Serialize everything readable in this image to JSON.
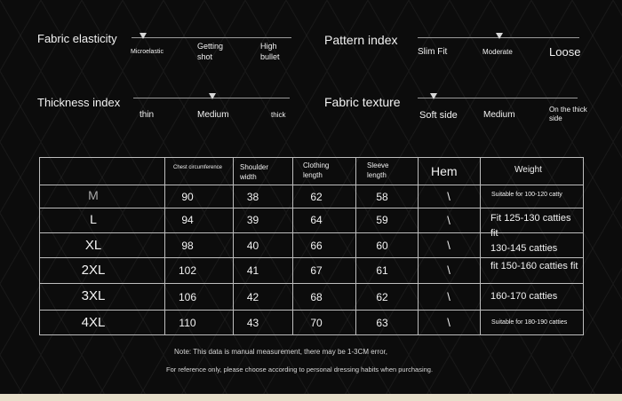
{
  "fabric_elasticity": {
    "title": "Fabric elasticity",
    "options": [
      "Microelastic",
      "Getting shot",
      "High bullet"
    ]
  },
  "pattern_index": {
    "title": "Pattern index",
    "options": [
      "Slim Fit",
      "Moderate",
      "Loose"
    ]
  },
  "thickness_index": {
    "title": "Thickness index",
    "options": [
      "thin",
      "Medium",
      "thick"
    ]
  },
  "fabric_texture": {
    "title": "Fabric texture",
    "options": [
      "Soft side",
      "Medium",
      "On the thick side"
    ]
  },
  "table": {
    "headers": [
      "Chest circumference",
      "Shoulder width",
      "Clothing length",
      "Sleeve length",
      "Hem",
      "Weight"
    ],
    "rows": [
      {
        "size": "M",
        "chest": "90",
        "shoulder": "38",
        "length": "62",
        "sleeve": "58",
        "hem": "\\",
        "weight": "Suitable for 100-120 catty"
      },
      {
        "size": "L",
        "chest": "94",
        "shoulder": "39",
        "length": "64",
        "sleeve": "59",
        "hem": "\\",
        "weight": "Fit 125-130 catties fit"
      },
      {
        "size": "XL",
        "chest": "98",
        "shoulder": "40",
        "length": "66",
        "sleeve": "60",
        "hem": "\\",
        "weight": "130-145 catties"
      },
      {
        "size": "2XL",
        "chest": "102",
        "shoulder": "41",
        "length": "67",
        "sleeve": "61",
        "hem": "\\",
        "weight": "fit 150-160 catties fit"
      },
      {
        "size": "3XL",
        "chest": "106",
        "shoulder": "42",
        "length": "68",
        "sleeve": "62",
        "hem": "\\",
        "weight": "160-170 catties"
      },
      {
        "size": "4XL",
        "chest": "110",
        "shoulder": "43",
        "length": "70",
        "sleeve": "63",
        "hem": "\\",
        "weight": "Suitable for 180-190 catties"
      }
    ]
  },
  "notes": {
    "line1": "Note: This data is manual measurement, there may be 1-3CM error,",
    "line2": "For reference only, please choose according to personal dressing habits when purchasing."
  },
  "colors": {
    "background": "#0c0c0c",
    "text": "#f2f2f2",
    "grid": "#bdbdbd",
    "bottom_strip": "#e8dfcb"
  }
}
